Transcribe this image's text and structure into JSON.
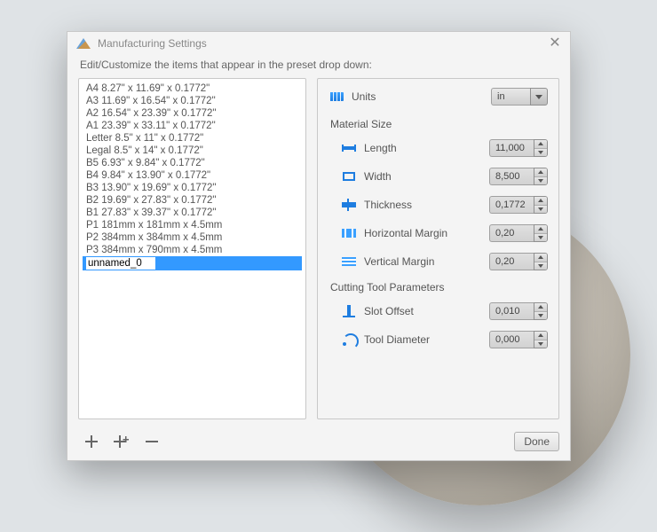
{
  "window": {
    "title": "Manufacturing Settings",
    "subtitle": "Edit/Customize the items that appear in the preset drop down:"
  },
  "presets": [
    "A4 8.27\" x 11.69\" x 0.1772\"",
    "A3 11.69\" x 16.54\" x 0.1772\"",
    "A2 16.54\" x 23.39\" x 0.1772\"",
    "A1 23.39\" x 33.11\" x 0.1772\"",
    "Letter 8.5\" x 11\" x 0.1772\"",
    "Legal 8.5\" x 14\" x 0.1772\"",
    "B5 6.93\" x 9.84\" x 0.1772\"",
    "B4 9.84\" x 13.90\" x 0.1772\"",
    "B3 13.90\" x 19.69\" x 0.1772\"",
    "B2 19.69\" x 27.83\" x 0.1772\"",
    "B1 27.83\" x 39.37\" x 0.1772\"",
    "P1 181mm x 181mm x 4.5mm",
    "P2 384mm x 384mm x 4.5mm",
    "P3 384mm x 790mm x 4.5mm"
  ],
  "editing_preset": "unnamed_0",
  "labels": {
    "units": "Units",
    "material_size": "Material Size",
    "length": "Length",
    "width": "Width",
    "thickness": "Thickness",
    "hmargin": "Horizontal Margin",
    "vmargin": "Vertical Margin",
    "cutting": "Cutting Tool Parameters",
    "slot": "Slot Offset",
    "tool": "Tool Diameter",
    "done": "Done"
  },
  "values": {
    "units": "in",
    "length": "11,000",
    "width": "8,500",
    "thickness": "0,1772",
    "hmargin": "0,20",
    "vmargin": "0,20",
    "slot": "0,010",
    "tool": "0,000"
  }
}
